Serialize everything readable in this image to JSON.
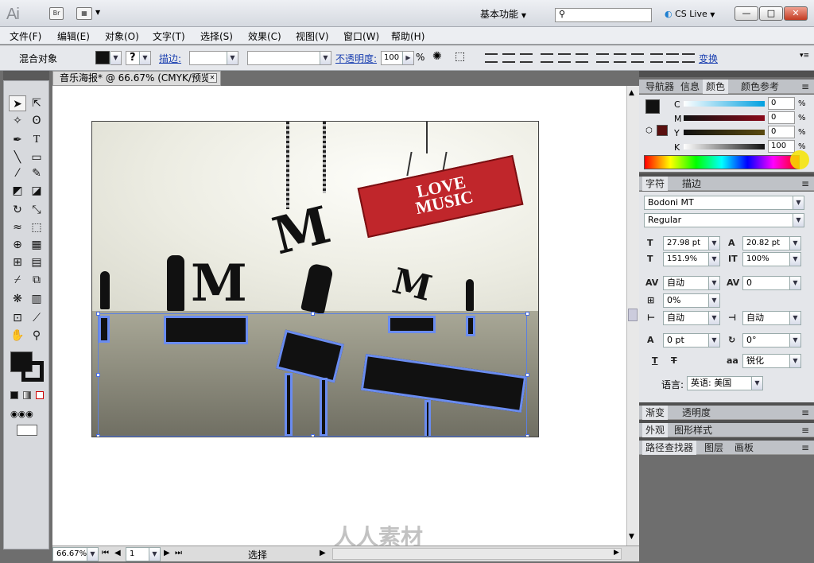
{
  "app": {
    "logo": "Ai",
    "bridge": "Br",
    "workspace": "基本功能",
    "cslive": "CS Live",
    "win_min": "—",
    "win_max": "□",
    "win_close": "✕"
  },
  "menu": [
    "文件(F)",
    "编辑(E)",
    "对象(O)",
    "文字(T)",
    "选择(S)",
    "效果(C)",
    "视图(V)",
    "窗口(W)",
    "帮助(H)"
  ],
  "control": {
    "object_label": "混合对象",
    "stroke_label": "描边:",
    "opacity_label": "不透明度:",
    "opacity_value": "100",
    "opacity_unit": "%",
    "transform_label": "变换"
  },
  "document": {
    "tab_title": "音乐海报* @ 66.67% (CMYK/预览)",
    "close": "✕"
  },
  "artwork": {
    "sign_line1": "LOVE",
    "sign_line2": "MUSIC",
    "m": "M"
  },
  "status": {
    "zoom": "66.67%",
    "page": "1",
    "mode": "选择"
  },
  "panels": {
    "color_tabs": [
      "导航器",
      "信息",
      "颜色",
      "颜色参考"
    ],
    "cmyk": [
      {
        "label": "C",
        "value": "0"
      },
      {
        "label": "M",
        "value": "0"
      },
      {
        "label": "Y",
        "value": "0"
      },
      {
        "label": "K",
        "value": "100"
      }
    ],
    "percent": "%",
    "char_tabs": [
      "字符",
      "描边"
    ],
    "font_family": "Bodoni MT",
    "font_style": "Regular",
    "font_size": "27.98 pt",
    "leading": "20.82 pt",
    "vscale": "151.9%",
    "hscale": "100%",
    "kerning": "自动",
    "tracking": "0",
    "tsume": "0%",
    "aki_left": "自动",
    "aki_right": "自动",
    "baseline": "0 pt",
    "rotation": "0°",
    "antialias": "锐化",
    "lang_label": "语言:",
    "lang": "英语: 美国",
    "grad_tabs": [
      "渐变",
      "透明度"
    ],
    "appear_tabs": [
      "外观",
      "图形样式"
    ],
    "path_tabs": [
      "路径查找器",
      "图层",
      "画板"
    ]
  },
  "watermark": "人人素材"
}
